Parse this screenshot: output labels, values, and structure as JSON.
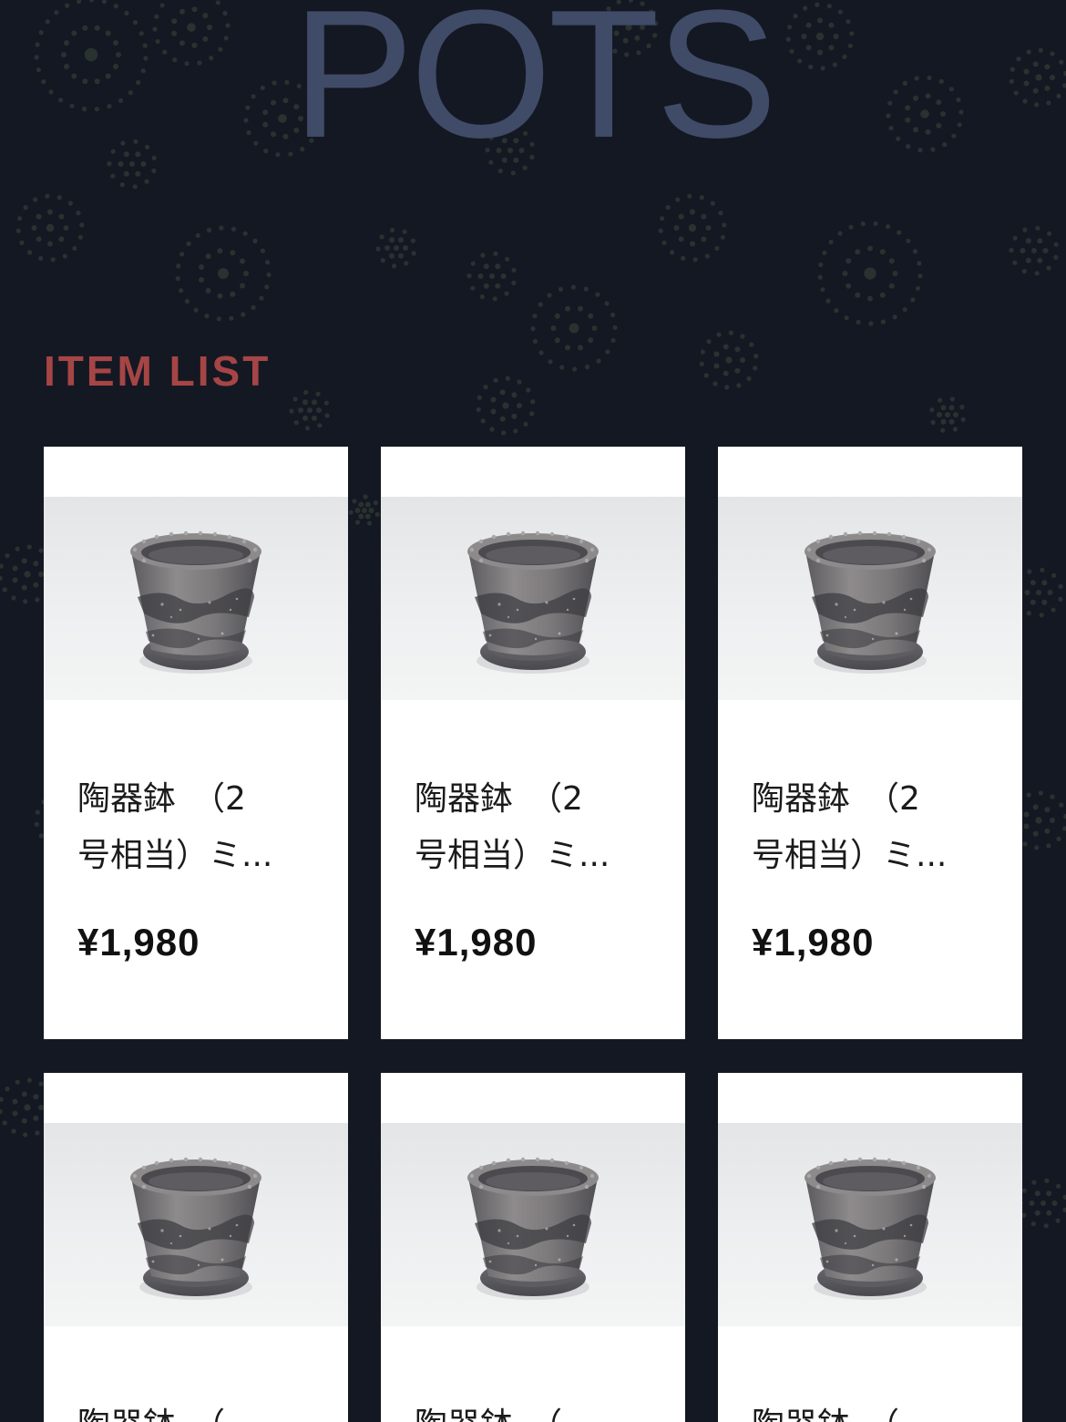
{
  "page": {
    "title": "POTS",
    "section_heading": "ITEM LIST"
  },
  "colors": {
    "background": "#141823",
    "title": "#3f4b67",
    "section_heading": "#a64545",
    "card": "#ffffff",
    "price": "#111111"
  },
  "products": [
    {
      "title_line1": "陶器鉢　（2",
      "title_line2": "号相当）ミ...",
      "price": "¥1,980",
      "image": "ceramic-pot-with-saucer"
    },
    {
      "title_line1": "陶器鉢　（2",
      "title_line2": "号相当）ミ...",
      "price": "¥1,980",
      "image": "ceramic-pot-with-saucer"
    },
    {
      "title_line1": "陶器鉢　（2",
      "title_line2": "号相当）ミ...",
      "price": "¥1,980",
      "image": "ceramic-pot-with-saucer"
    },
    {
      "title_line1": "陶器鉢　（",
      "title_line2": "",
      "price": "",
      "image": "ceramic-pot-with-saucer"
    },
    {
      "title_line1": "陶器鉢　（",
      "title_line2": "",
      "price": "",
      "image": "ceramic-pot-with-saucer"
    },
    {
      "title_line1": "陶器鉢　（",
      "title_line2": "",
      "price": "",
      "image": "ceramic-pot-with-saucer"
    }
  ]
}
